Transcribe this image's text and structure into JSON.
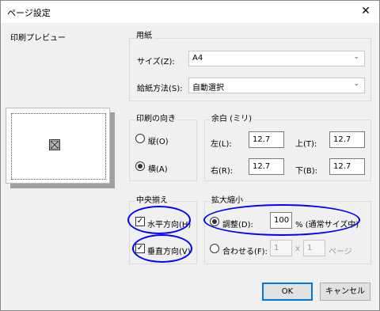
{
  "window": {
    "title": "ページ設定",
    "close_glyph": "✕"
  },
  "preview": {
    "label": "印刷プレビュー"
  },
  "paper": {
    "group_label": "用紙",
    "size_label": "サイズ(Z):",
    "size_value": "A4",
    "feed_label": "給紙方法(S):",
    "feed_value": "自動選択",
    "chevron": "⌄"
  },
  "orientation": {
    "group_label": "印刷の向き",
    "portrait_label": "縦(O)",
    "landscape_label": "横(A)",
    "selected": "landscape"
  },
  "margins": {
    "group_label": "余白 (ミリ)",
    "left_label": "左(L):",
    "left_value": "12.7",
    "top_label": "上(T):",
    "top_value": "12.7",
    "right_label": "右(R):",
    "right_value": "12.7",
    "bottom_label": "下(B):",
    "bottom_value": "12.7"
  },
  "center": {
    "group_label": "中央揃え",
    "horizontal_label": "水平方向(H)",
    "vertical_label": "垂直方向(V)",
    "horizontal_checked": true,
    "vertical_checked": true,
    "check_glyph": "✓"
  },
  "scale": {
    "group_label": "拡大縮小",
    "adjust_label": "調整(D):",
    "adjust_value": "100",
    "adjust_suffix": "% (通常サイズ中)",
    "fit_label": "合わせる(F):",
    "fit_wide_value": "1",
    "fit_x": "x",
    "fit_tall_value": "1",
    "fit_suffix": "ページ",
    "selected": "adjust"
  },
  "buttons": {
    "ok": "OK",
    "cancel": "キャンセル"
  },
  "colors": {
    "annotation_oval": "#0000ff",
    "default_button_border": "#0078d7"
  }
}
